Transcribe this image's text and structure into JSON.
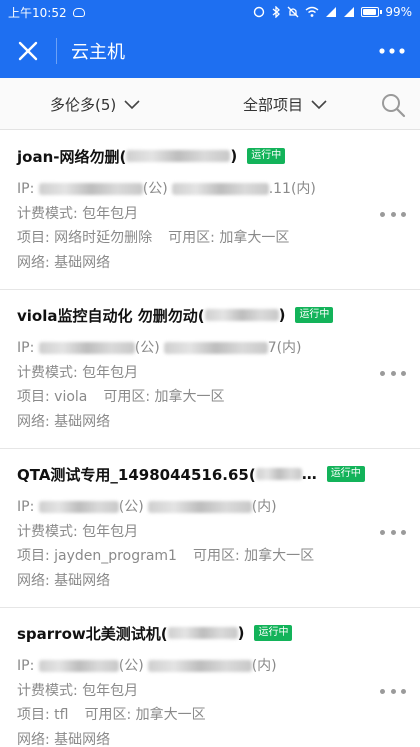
{
  "status_bar": {
    "time": "上午10:52",
    "battery": "99%",
    "battery_level": 0.99
  },
  "header": {
    "title": "云主机",
    "close_icon": "close-icon",
    "more_icon": "more-icon"
  },
  "filters": {
    "region": "多伦多(5)",
    "project": "全部项目",
    "search_icon": "search-icon"
  },
  "colors": {
    "brand": "#1e6ff1",
    "running": "#13b35a"
  },
  "instances": [
    {
      "name": "joan-网络勿删(",
      "close_paren": ")",
      "status": "运行中",
      "ip_prefix": "IP: ",
      "ip_mid": "(公)",
      "ip_tail": ".11(内)",
      "billing": "计费模式: 包年包月",
      "project": "项目: 网络时延勿删除",
      "zone": "可用区: 加拿大一区",
      "network": "网络: 基础网络"
    },
    {
      "name": "viola监控自动化 勿删勿动(",
      "close_paren": ")",
      "status": "运行中",
      "ip_prefix": "IP: ",
      "ip_mid": "(公)",
      "ip_tail": "7(内)",
      "billing": "计费模式: 包年包月",
      "project": "项目: viola",
      "zone": "可用区: 加拿大一区",
      "network": "网络: 基础网络"
    },
    {
      "name": "QTA测试专用_1498044516.65(",
      "close_paren": "…",
      "status": "运行中",
      "ip_prefix": "IP: ",
      "ip_mid": "(公)",
      "ip_tail": "(内)",
      "billing": "计费模式: 包年包月",
      "project": "项目: jayden_program1",
      "zone": "可用区: 加拿大一区",
      "network": "网络: 基础网络"
    },
    {
      "name": "sparrow北美测试机(",
      "close_paren": ")",
      "status": "运行中",
      "ip_prefix": "IP: ",
      "ip_mid": "(公)",
      "ip_tail": "(内)",
      "billing": "计费模式: 包年包月",
      "project": "项目: tfl",
      "zone": "可用区: 加拿大一区",
      "network": "网络: 基础网络"
    }
  ]
}
